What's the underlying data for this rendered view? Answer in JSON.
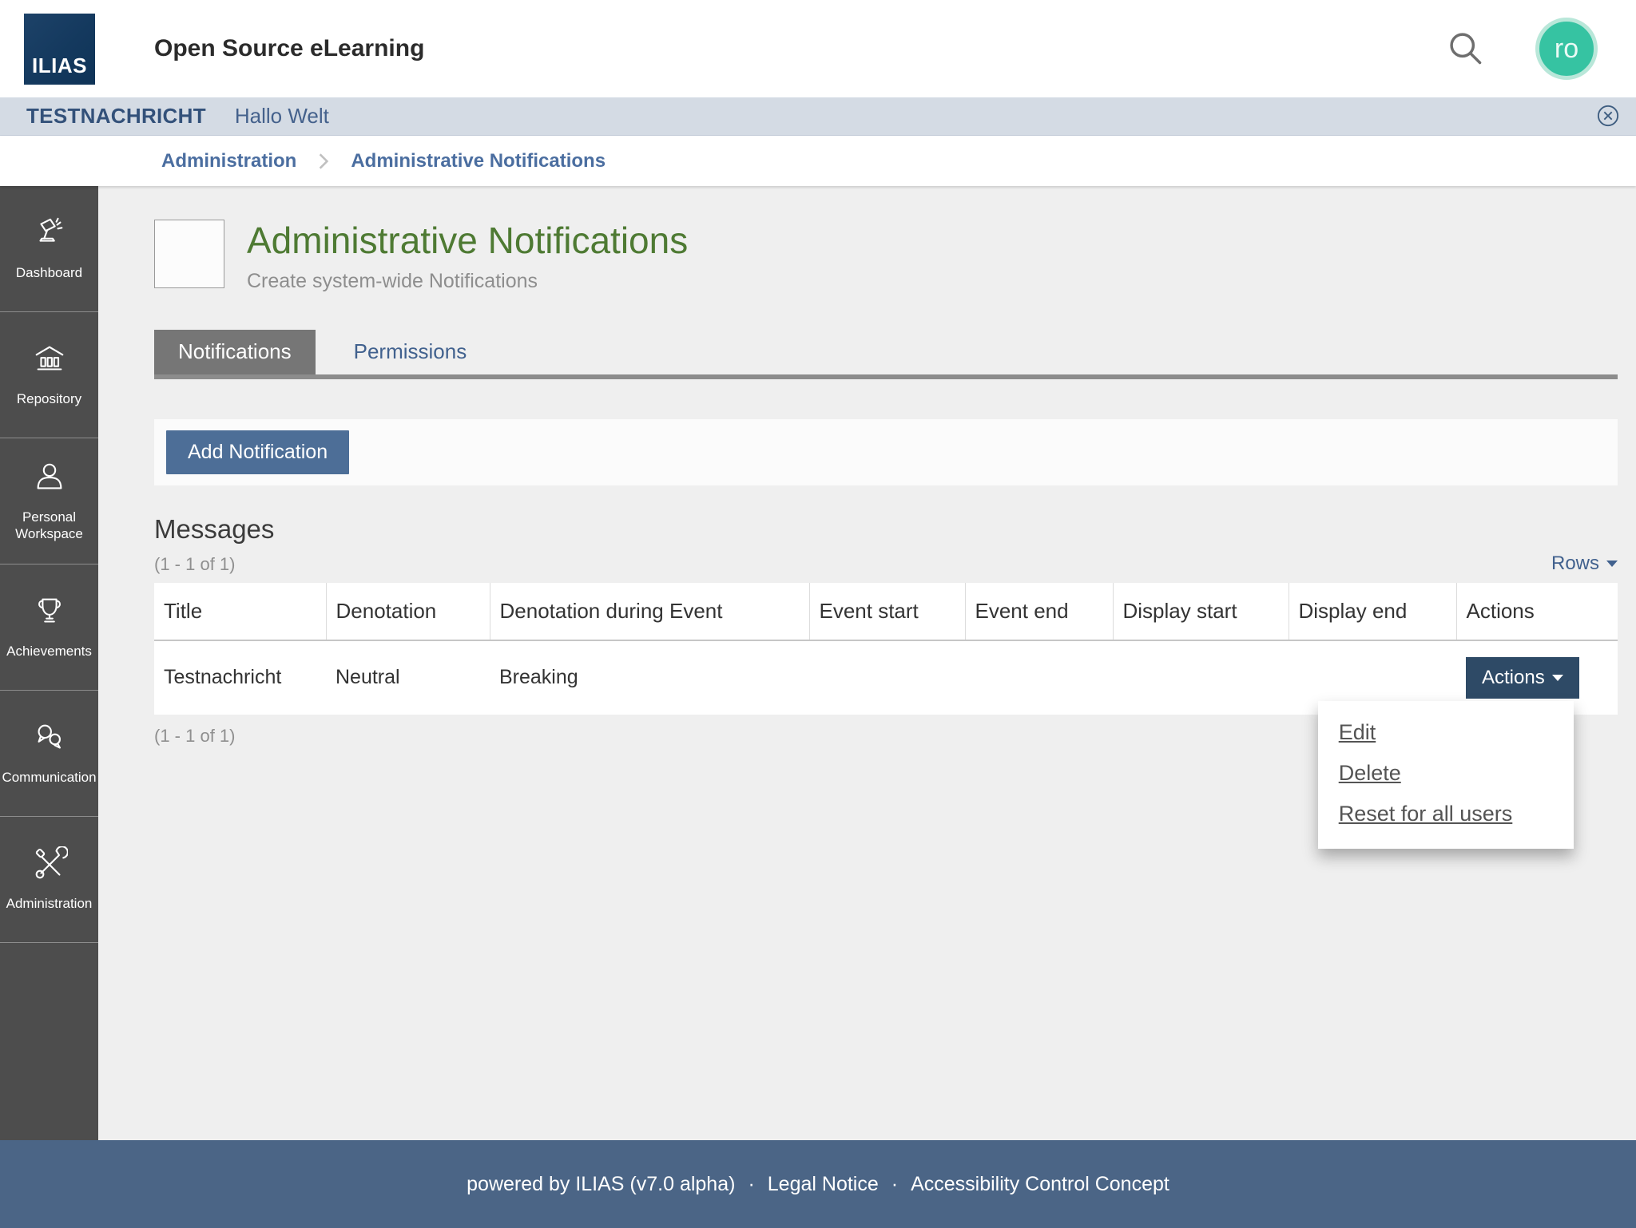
{
  "header": {
    "logo_text": "ILIAS",
    "title": "Open Source eLearning",
    "avatar_initials": "ro"
  },
  "notification_bar": {
    "label": "TESTNACHRICHT",
    "message": "Hallo Welt"
  },
  "breadcrumb": {
    "items": [
      "Administration",
      "Administrative Notifications"
    ]
  },
  "sidebar": {
    "items": [
      {
        "label": "Dashboard"
      },
      {
        "label": "Repository"
      },
      {
        "label": "Personal Workspace"
      },
      {
        "label": "Achievements"
      },
      {
        "label": "Communication"
      },
      {
        "label": "Administration"
      }
    ]
  },
  "page": {
    "title": "Administrative Notifications",
    "subtitle": "Create system-wide Notifications"
  },
  "tabs": [
    {
      "label": "Notifications",
      "active": true
    },
    {
      "label": "Permissions",
      "active": false
    }
  ],
  "toolbar": {
    "add_button": "Add Notification"
  },
  "messages": {
    "heading": "Messages",
    "count_top": "(1 - 1 of 1)",
    "count_bottom": "(1 - 1 of 1)",
    "rows_label": "Rows",
    "table": {
      "columns": [
        "Title",
        "Denotation",
        "Denotation during Event",
        "Event start",
        "Event end",
        "Display start",
        "Display end",
        "Actions"
      ],
      "rows": [
        {
          "title": "Testnachricht",
          "denotation": "Neutral",
          "denotation_during_event": "Breaking",
          "event_start": "",
          "event_end": "",
          "display_start": "",
          "display_end": "",
          "actions_label": "Actions"
        }
      ]
    },
    "actions_menu": {
      "items": [
        "Edit",
        "Delete",
        "Reset for all users"
      ]
    }
  },
  "footer": {
    "powered_by": "powered by ILIAS (v7.0 alpha)",
    "separator": "·",
    "links": [
      "Legal Notice",
      "Accessibility Control Concept"
    ]
  },
  "colors": {
    "logo_bg": "#14395e",
    "avatar_bg": "#36c3a2",
    "notification_bar_bg": "#d4dbe4",
    "brand_blue": "#4d6e97",
    "actions_navy": "#2e4a66",
    "title_green": "#4e7a33",
    "sidebar_bg": "#4d4d4d",
    "footer_bg": "#4b6586",
    "link_blue": "#41618e",
    "active_tab_bg": "#767676",
    "content_bg": "#efefef"
  }
}
